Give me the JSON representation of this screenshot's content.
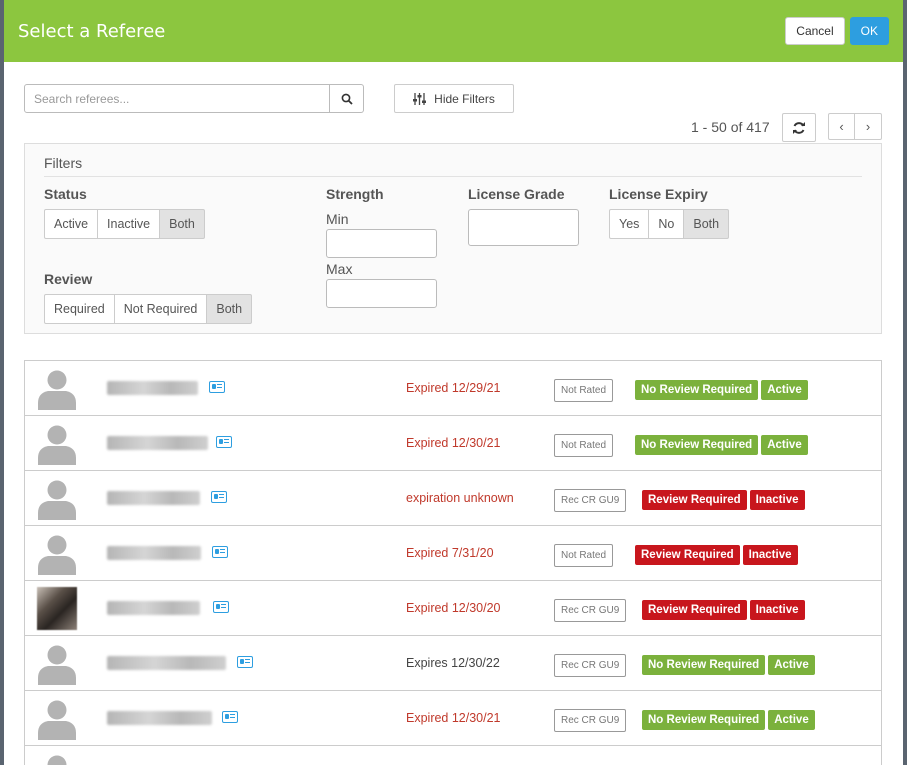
{
  "dialog": {
    "title": "Select a Referee",
    "cancel_label": "Cancel",
    "ok_label": "OK"
  },
  "search": {
    "placeholder": "Search referees...",
    "hide_filters_label": "Hide Filters"
  },
  "pager": {
    "text": "1 - 50 of 417"
  },
  "filters": {
    "title": "Filters",
    "status": {
      "label": "Status",
      "options": [
        "Active",
        "Inactive",
        "Both"
      ],
      "selected": "Both"
    },
    "review": {
      "label": "Review",
      "options": [
        "Required",
        "Not Required",
        "Both"
      ],
      "selected": "Both"
    },
    "strength": {
      "label": "Strength",
      "min_label": "Min",
      "max_label": "Max"
    },
    "license_grade": {
      "label": "License Grade"
    },
    "license_expiry": {
      "label": "License Expiry",
      "options": [
        "Yes",
        "No",
        "Both"
      ],
      "selected": "Both"
    }
  },
  "colors": {
    "header": "#8cc63f",
    "ok_button": "#2d9ee0",
    "green_badge": "#7bb13c",
    "red_badge": "#c8161d",
    "expired_text": "#c0392b"
  },
  "referees": [
    {
      "expiry": "Expired 12/29/21",
      "rating": "Not Rated",
      "review": "No Review Required",
      "status": "Active"
    },
    {
      "expiry": "Expired 12/30/21",
      "rating": "Not Rated",
      "review": "No Review Required",
      "status": "Active"
    },
    {
      "expiry": "expiration unknown",
      "rating": "Rec CR GU9",
      "review": "Review Required",
      "status": "Inactive"
    },
    {
      "expiry": "Expired 7/31/20",
      "rating": "Not Rated",
      "review": "Review Required",
      "status": "Inactive"
    },
    {
      "expiry": "Expired 12/30/20",
      "rating": "Rec CR GU9",
      "review": "Review Required",
      "status": "Inactive"
    },
    {
      "expiry": "Expires 12/30/22",
      "rating": "Rec CR GU9",
      "review": "No Review Required",
      "status": "Active"
    },
    {
      "expiry": "Expired 12/30/21",
      "rating": "Rec CR GU9",
      "review": "No Review Required",
      "status": "Active"
    }
  ]
}
